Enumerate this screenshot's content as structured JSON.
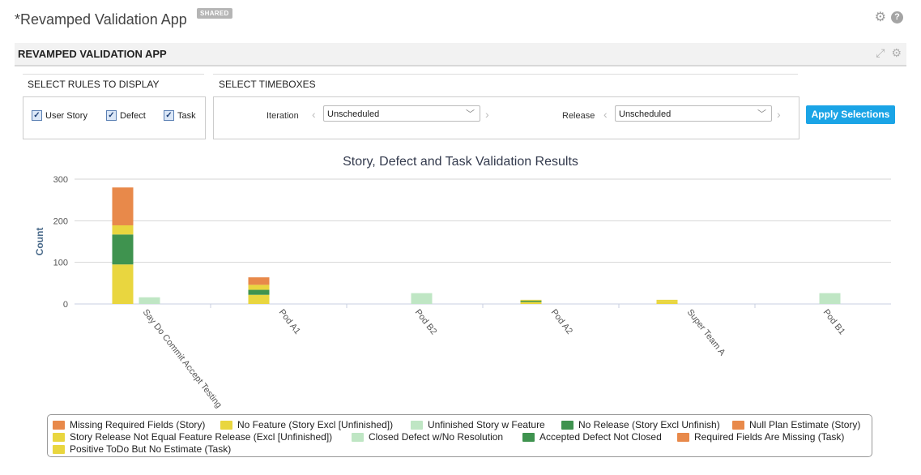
{
  "app": {
    "title": "*Revamped Validation App",
    "shared_badge": "SHARED"
  },
  "panel": {
    "title": "REVAMPED VALIDATION APP"
  },
  "rules": {
    "label": "SELECT RULES TO DISPLAY",
    "items": [
      {
        "label": "User Story",
        "checked": true
      },
      {
        "label": "Defect",
        "checked": true
      },
      {
        "label": "Task",
        "checked": true
      }
    ]
  },
  "timeboxes": {
    "label": "SELECT TIMEBOXES",
    "iteration_label": "Iteration",
    "iteration_value": "Unscheduled",
    "release_label": "Release",
    "release_value": "Unscheduled"
  },
  "apply_button": "Apply Selections",
  "colors": {
    "orange": "#e8894a",
    "yellow": "#e9d63f",
    "light_green": "#bfe6c4",
    "dark_green": "#3f934f",
    "accent": "#1aa4e6"
  },
  "chart_data": {
    "type": "bar",
    "stacked": true,
    "title": "Story, Defect and Task Validation Results",
    "ylabel": "Count",
    "xlabel": "",
    "ylim": [
      0,
      300
    ],
    "yticks": [
      0,
      100,
      200,
      300
    ],
    "grid": true,
    "legend_position": "bottom",
    "categories": [
      "Say Do Commit Accept Testing",
      "Pod A1",
      "Pod B2",
      "Pod A2",
      "Super Team A",
      "Pod B1"
    ],
    "stacks": [
      {
        "name": "Story",
        "series": [
          {
            "name": "Positive ToDo But No Estimate (Task)",
            "color": "#e9d63f",
            "values": [
              0,
              0,
              0,
              0,
              0,
              0
            ]
          },
          {
            "name": "Story Release Not Equal Feature Release (Excl [Unfinished])",
            "color": "#e9d63f",
            "values": [
              0,
              0,
              0,
              0,
              0,
              0
            ]
          },
          {
            "name": "No Feature (Story Excl [Unfinished])",
            "color": "#e9d63f",
            "values": [
              95,
              22,
              0,
              5,
              7,
              0
            ]
          },
          {
            "name": "No Release (Story Excl Unfinish)",
            "color": "#3f934f",
            "values": [
              72,
              12,
              0,
              3,
              0,
              0
            ]
          },
          {
            "name": "Unfinished Story w Feature",
            "color": "#bfe6c4",
            "values": [
              0,
              0,
              0,
              0,
              0,
              0
            ]
          },
          {
            "name": "Null Plan Estimate (Story)",
            "color": "#e9d63f",
            "values": [
              22,
              12,
              0,
              2,
              3,
              0
            ]
          },
          {
            "name": "Missing Required Fields (Story)",
            "color": "#e8894a",
            "values": [
              91,
              18,
              0,
              0,
              0,
              0
            ]
          }
        ]
      },
      {
        "name": "Defect",
        "series": [
          {
            "name": "Closed Defect w/No Resolution",
            "color": "#bfe6c4",
            "values": [
              16,
              0,
              26,
              0,
              0,
              26
            ]
          },
          {
            "name": "Accepted Defect Not Closed",
            "color": "#3f934f",
            "values": [
              0,
              0,
              0,
              0,
              0,
              0
            ]
          },
          {
            "name": "Required Fields Are Missing (Task)",
            "color": "#e8894a",
            "values": [
              0,
              0,
              0,
              0,
              0,
              0
            ]
          }
        ]
      }
    ],
    "legend": [
      {
        "name": "Missing Required Fields (Story)",
        "color": "#e8894a"
      },
      {
        "name": "No Feature (Story Excl [Unfinished])",
        "color": "#e9d63f"
      },
      {
        "name": "Unfinished Story w Feature",
        "color": "#bfe6c4"
      },
      {
        "name": "No Release (Story Excl Unfinish)",
        "color": "#3f934f"
      },
      {
        "name": "Null Plan Estimate (Story)",
        "color": "#e8894a"
      },
      {
        "name": "Story Release Not Equal Feature Release (Excl [Unfinished])",
        "color": "#e9d63f"
      },
      {
        "name": "Closed Defect w/No Resolution",
        "color": "#bfe6c4"
      },
      {
        "name": "Accepted Defect Not Closed",
        "color": "#3f934f"
      },
      {
        "name": "Required Fields Are Missing (Task)",
        "color": "#e8894a"
      },
      {
        "name": "Positive ToDo But No Estimate (Task)",
        "color": "#e9d63f"
      }
    ]
  }
}
